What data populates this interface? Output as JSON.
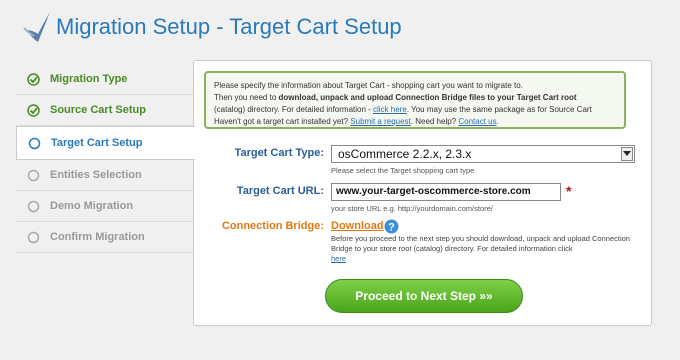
{
  "header": {
    "title": "Migration Setup - Target Cart Setup",
    "logo_icon": "migration-logo-icon"
  },
  "sidebar": {
    "steps": [
      {
        "label": "Migration Type",
        "state": "done"
      },
      {
        "label": "Source Cart Setup",
        "state": "done"
      },
      {
        "label": "Target Cart Setup",
        "state": "active"
      },
      {
        "label": "Entities Selection",
        "state": "pending"
      },
      {
        "label": "Demo Migration",
        "state": "pending"
      },
      {
        "label": "Confirm Migration",
        "state": "pending"
      }
    ]
  },
  "info": {
    "line1": "Please specify the information about Target Cart - shopping cart you want to migrate to.",
    "line2_pre": "Then you need to ",
    "line2_bold": "download, unpack and upload Connection Bridge files to your Target Cart root",
    "line3_pre": "(catalog) directory. For detailed information - ",
    "line3_link": "click here",
    "line3_post": ". You may use the same package as for Source Cart",
    "line4_pre": "Haven't got a target cart installed yet? ",
    "line4_link1": "Submit a request",
    "line4_mid": ". Need help? ",
    "line4_link2": "Contact us",
    "line4_post": "."
  },
  "form": {
    "cart_type_label": "Target Cart Type:",
    "cart_type_value": "osCommerce 2.2.x, 2.3.x",
    "cart_type_hint": "Please select the Target shopping cart type",
    "cart_url_label": "Target Cart URL:",
    "cart_url_value": "www.your-target-oscommerce-store.com",
    "cart_url_required": "*",
    "cart_url_hint": "your store URL e.g. http://yourdomain.com/store/",
    "bridge_label": "Connection Bridge:",
    "bridge_link": "Download",
    "bridge_desc": "Before you proceed to the next step you should download, unpack and upload Connection Bridge to your store root (catalog) directory. For detailed information click",
    "bridge_desc_link": "here"
  },
  "actions": {
    "proceed_label": "Proceed to Next Step »»"
  },
  "colors": {
    "accent": "#2a7ab8",
    "done": "#4a8a24",
    "orange": "#e07a10",
    "button": "#5cb82a"
  }
}
